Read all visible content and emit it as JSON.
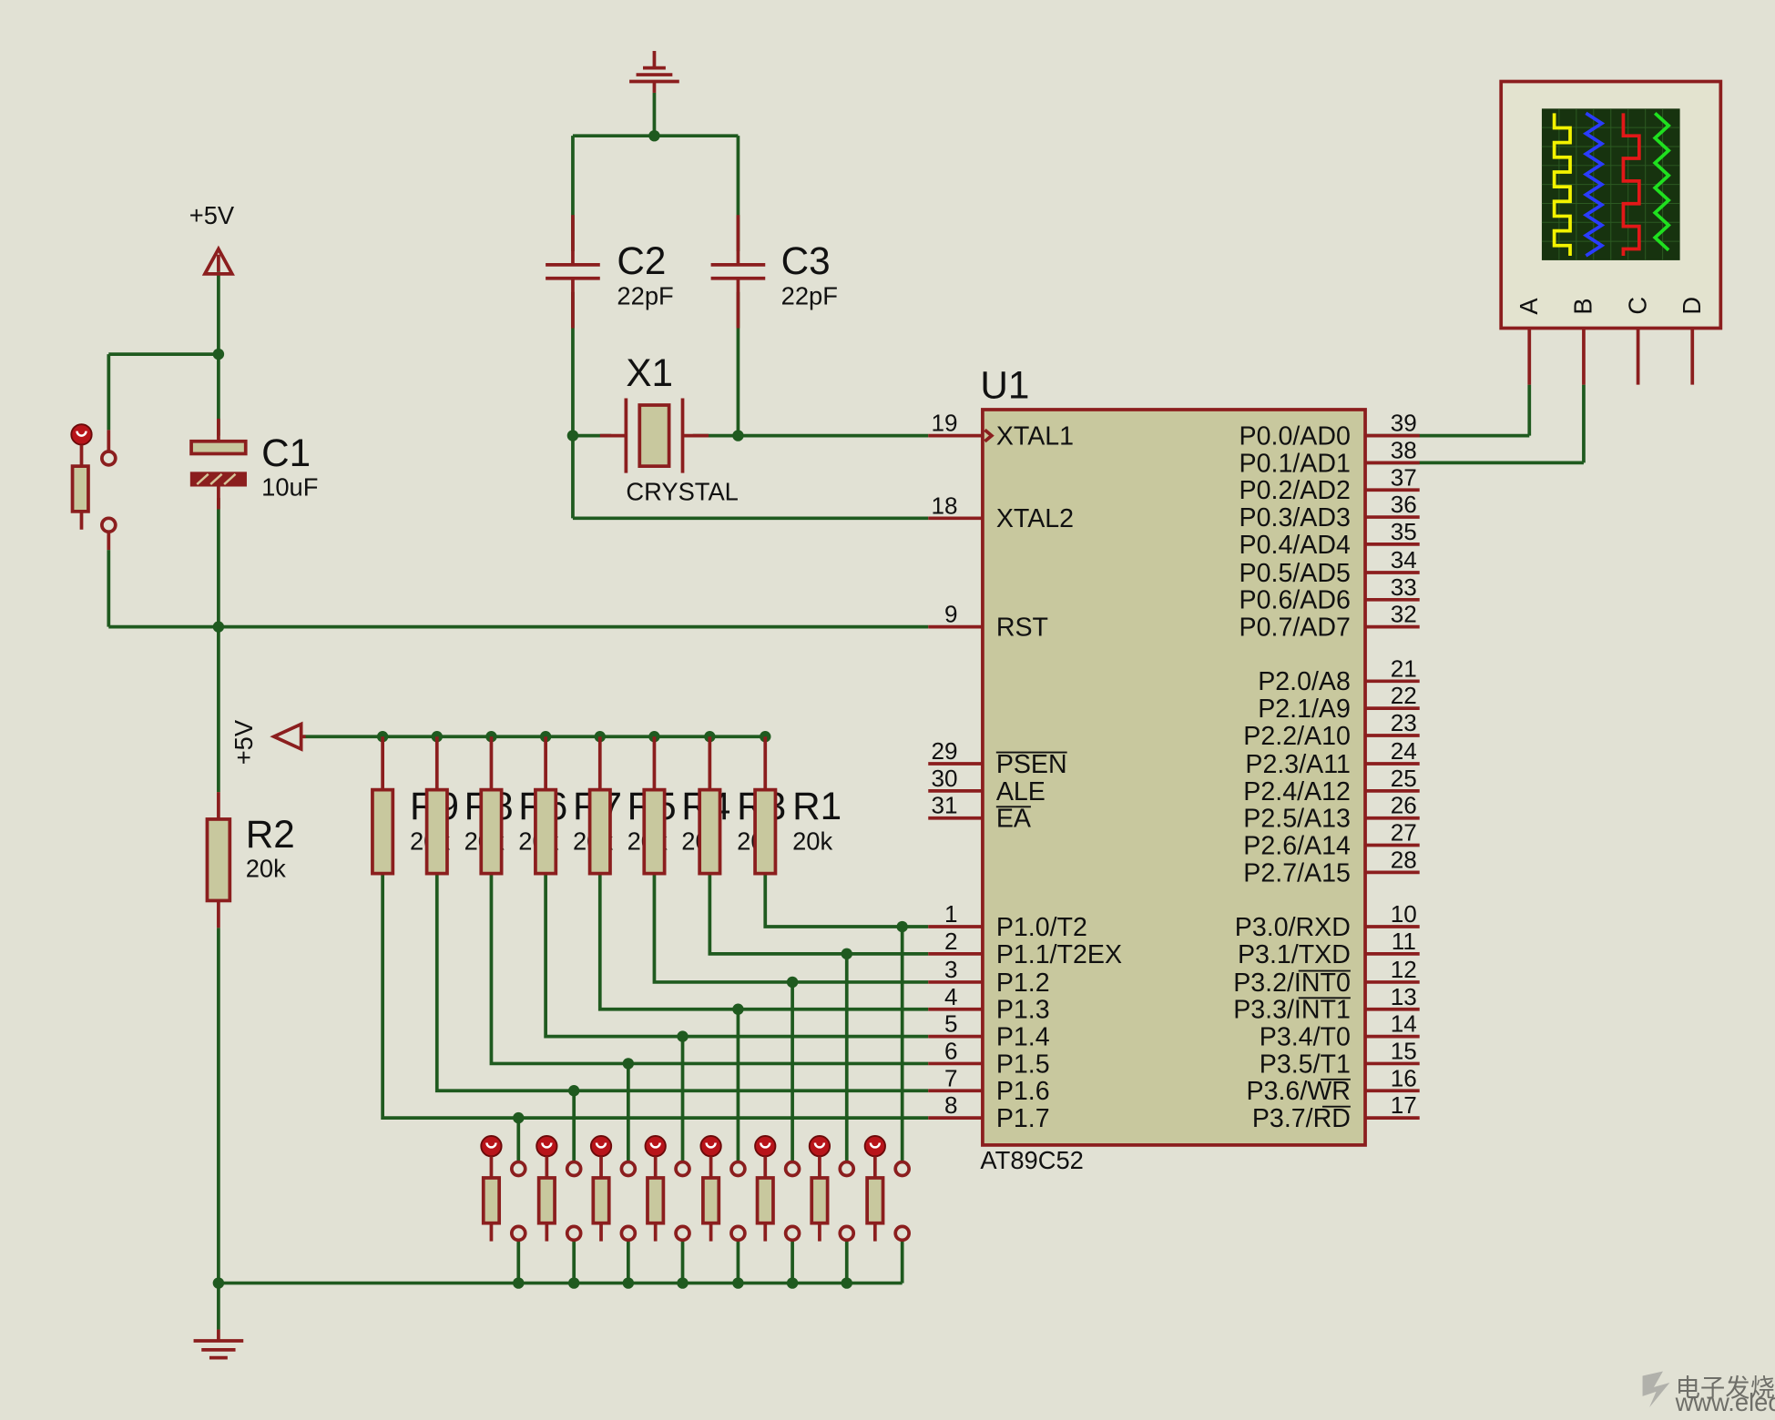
{
  "power": {
    "vcc_top": "+5V",
    "vcc_bus": "+5V"
  },
  "components": {
    "C1": {
      "ref": "C1",
      "value": "10uF"
    },
    "C2": {
      "ref": "C2",
      "value": "22pF"
    },
    "C3": {
      "ref": "C3",
      "value": "22pF"
    },
    "X1": {
      "ref": "X1",
      "value": "CRYSTAL"
    },
    "R2": {
      "ref": "R2",
      "value": "20k"
    },
    "U1": {
      "ref": "U1",
      "part": "AT89C52"
    }
  },
  "resistor_bank": [
    {
      "ref": "R9",
      "value": "20k"
    },
    {
      "ref": "R8",
      "value": "20k"
    },
    {
      "ref": "R6",
      "value": "20k"
    },
    {
      "ref": "R7",
      "value": "20k"
    },
    {
      "ref": "R5",
      "value": "20k"
    },
    {
      "ref": "R4",
      "value": "20k"
    },
    {
      "ref": "R3",
      "value": "20k"
    },
    {
      "ref": "R1",
      "value": "20k"
    }
  ],
  "u1_left_pins": [
    {
      "num": "19",
      "name": "XTAL1"
    },
    {
      "num": "18",
      "name": "XTAL2"
    },
    {
      "num": "9",
      "name": "RST"
    },
    {
      "num": "29",
      "name": "PSEN"
    },
    {
      "num": "30",
      "name": "ALE"
    },
    {
      "num": "31",
      "name": "EA"
    },
    {
      "num": "1",
      "name": "P1.0/T2"
    },
    {
      "num": "2",
      "name": "P1.1/T2EX"
    },
    {
      "num": "3",
      "name": "P1.2"
    },
    {
      "num": "4",
      "name": "P1.3"
    },
    {
      "num": "5",
      "name": "P1.4"
    },
    {
      "num": "6",
      "name": "P1.5"
    },
    {
      "num": "7",
      "name": "P1.6"
    },
    {
      "num": "8",
      "name": "P1.7"
    }
  ],
  "u1_right_pins": [
    {
      "num": "39",
      "name": "P0.0/AD0"
    },
    {
      "num": "38",
      "name": "P0.1/AD1"
    },
    {
      "num": "37",
      "name": "P0.2/AD2"
    },
    {
      "num": "36",
      "name": "P0.3/AD3"
    },
    {
      "num": "35",
      "name": "P0.4/AD4"
    },
    {
      "num": "34",
      "name": "P0.5/AD5"
    },
    {
      "num": "33",
      "name": "P0.6/AD6"
    },
    {
      "num": "32",
      "name": "P0.7/AD7"
    },
    {
      "num": "21",
      "name": "P2.0/A8"
    },
    {
      "num": "22",
      "name": "P2.1/A9"
    },
    {
      "num": "23",
      "name": "P2.2/A10"
    },
    {
      "num": "24",
      "name": "P2.3/A11"
    },
    {
      "num": "25",
      "name": "P2.4/A12"
    },
    {
      "num": "26",
      "name": "P2.5/A13"
    },
    {
      "num": "27",
      "name": "P2.6/A14"
    },
    {
      "num": "28",
      "name": "P2.7/A15"
    },
    {
      "num": "10",
      "name": "P3.0/RXD"
    },
    {
      "num": "11",
      "name": "P3.1/TXD"
    },
    {
      "num": "12",
      "name": "P3.2/INT0"
    },
    {
      "num": "13",
      "name": "P3.3/INT1"
    },
    {
      "num": "14",
      "name": "P3.4/T0"
    },
    {
      "num": "15",
      "name": "P3.5/T1"
    },
    {
      "num": "16",
      "name": "P3.6/WR"
    },
    {
      "num": "17",
      "name": "P3.7/RD"
    }
  ],
  "scope": {
    "channels": [
      "A",
      "B",
      "C",
      "D"
    ],
    "trace_colors": [
      "#f2f200",
      "#2a3cff",
      "#e21818",
      "#1fe01f"
    ]
  },
  "watermark": {
    "text": "电子发烧友",
    "url": "www.elecfans.com"
  }
}
